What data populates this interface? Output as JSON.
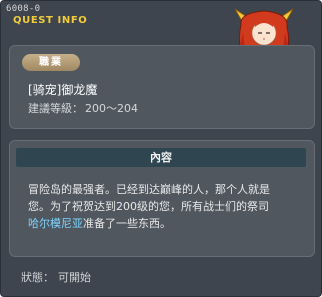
{
  "window": {
    "id": "6008-0",
    "title": "QUEST INFO"
  },
  "job": {
    "badge": "職業",
    "name": "[骑宠]御龙魔",
    "level_label": "建議等級：",
    "level_value": "200～204"
  },
  "content": {
    "header": "內容",
    "line1": "冒险岛的最强者。已经到达巅峰的人，那个人就是",
    "line2": "您。为了祝贺达到200级的您，所有战士们的祭司",
    "link_text": "哈尔模尼亚",
    "line3_rest": "准备了一些东西。"
  },
  "status": {
    "label": "狀態：",
    "value": "可開始"
  },
  "colors": {
    "title": "#f2cc3c",
    "link": "#7fd5ff",
    "badge": "#b39d76",
    "header_bar": "#2f4651"
  },
  "icons": {
    "character": "red-haired-dragon-rider-sprite"
  }
}
